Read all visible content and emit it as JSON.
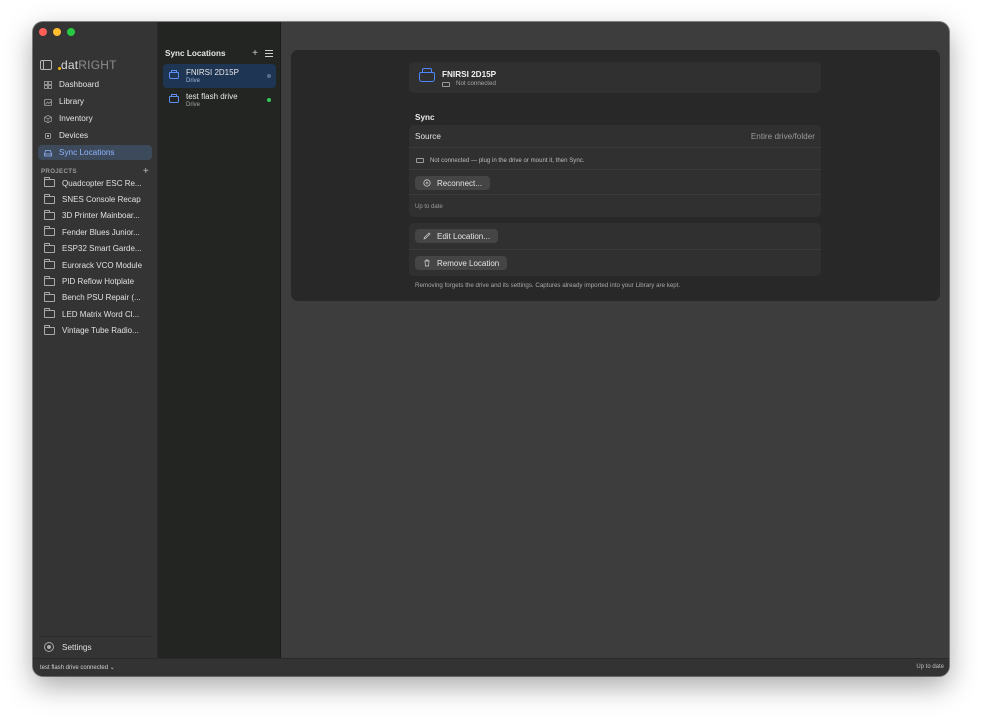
{
  "app": {
    "brand_primary": "dat",
    "brand_secondary": "RIGHT",
    "accent_color": "#4e86ff",
    "status_connected_color": "#34c759"
  },
  "sidebar": {
    "nav": [
      {
        "label": "Dashboard",
        "icon": "grid-icon"
      },
      {
        "label": "Library",
        "icon": "photo-stack-icon"
      },
      {
        "label": "Inventory",
        "icon": "box-icon"
      },
      {
        "label": "Devices",
        "icon": "chip-icon"
      },
      {
        "label": "Sync Locations",
        "icon": "drive-icon",
        "active": true
      }
    ],
    "projects_header": "PROJECTS",
    "projects": [
      "Quadcopter ESC Re...",
      "SNES Console Recap",
      "3D Printer Mainboar...",
      "Fender Blues Junior...",
      "ESP32 Smart Garde...",
      "Eurorack VCO Module",
      "PID Reflow Hotplate",
      "Bench PSU Repair (...",
      "LED Matrix Word Cl...",
      "Vintage Tube Radio..."
    ],
    "settings_label": "Settings"
  },
  "locations": {
    "title": "Sync Locations",
    "items": [
      {
        "name": "FNIRSI 2D15P",
        "type": "Drive",
        "status": "disconnected",
        "active": true
      },
      {
        "name": "test flash drive",
        "type": "Drive",
        "status": "connected",
        "active": false
      }
    ]
  },
  "detail": {
    "device_name": "FNIRSI 2D15P",
    "device_status": "Not connected",
    "sync_section_title": "Sync",
    "source_label": "Source",
    "source_value": "Entire drive/folder",
    "disconnected_note": "Not connected — plug in the drive or mount it, then Sync.",
    "reconnect_label": "Reconnect...",
    "sync_status": "Up to date",
    "edit_label": "Edit Location...",
    "remove_label": "Remove Location",
    "remove_warning": "Removing forgets the drive and its settings. Captures already imported into your Library are kept."
  },
  "statusbar": {
    "left": "test flash drive connected",
    "right": "Up to date"
  }
}
